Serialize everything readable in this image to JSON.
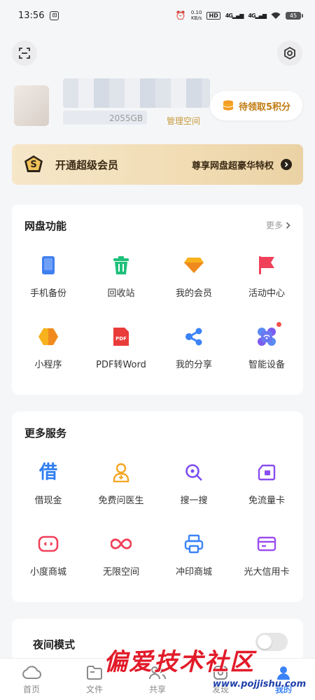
{
  "status_bar": {
    "time": "13:56",
    "net_speed_value": "0.10",
    "net_speed_unit": "KB/s",
    "hd_label": "HD",
    "signal_1": "4G",
    "signal_2": "4G",
    "battery": "45"
  },
  "profile": {
    "storage": "2055GB",
    "manage_space": "管理空间",
    "points_pill": "待领取5积分"
  },
  "vip_banner": {
    "badge": "S",
    "title": "开通超级会员",
    "desc": "尊享网盘超豪华特权"
  },
  "functions": {
    "title": "网盘功能",
    "more": "更多",
    "items": [
      {
        "label": "手机备份",
        "icon": "phone-backup-icon",
        "color": "#3f7ff0"
      },
      {
        "label": "回收站",
        "icon": "recycle-bin-icon",
        "color": "#1fc07a"
      },
      {
        "label": "我的会员",
        "icon": "membership-diamond-icon",
        "color": "#f4a623"
      },
      {
        "label": "活动中心",
        "icon": "activity-flag-icon",
        "color": "#f0415a"
      },
      {
        "label": "小程序",
        "icon": "mini-program-icon",
        "color": "#f7b21e"
      },
      {
        "label": "PDF转Word",
        "icon": "pdf-icon",
        "color": "#ea3b3b"
      },
      {
        "label": "我的分享",
        "icon": "share-icon",
        "color": "#3b82f6"
      },
      {
        "label": "智能设备",
        "icon": "smart-device-icon",
        "color": "#4f7ef0"
      }
    ]
  },
  "more_services": {
    "title": "更多服务",
    "items": [
      {
        "label": "借现金",
        "icon": "borrow-cash-icon",
        "color": "#2f7ef0"
      },
      {
        "label": "免费问医生",
        "icon": "doctor-icon",
        "color": "#f4a623"
      },
      {
        "label": "搜一搜",
        "icon": "search-icon",
        "color": "#7b4df0"
      },
      {
        "label": "免流量卡",
        "icon": "sim-card-icon",
        "color": "#8a4df0"
      },
      {
        "label": "小度商城",
        "icon": "xiaodu-mall-icon",
        "color": "#f0415a"
      },
      {
        "label": "无限空间",
        "icon": "infinity-icon",
        "color": "#f0415a"
      },
      {
        "label": "冲印商城",
        "icon": "printer-icon",
        "color": "#3b82f6"
      },
      {
        "label": "光大信用卡",
        "icon": "credit-card-icon",
        "color": "#9b4df0"
      }
    ]
  },
  "night_mode": {
    "label": "夜间模式"
  },
  "tab_bar": {
    "tabs": [
      {
        "label": "首页",
        "icon": "home-cloud-icon"
      },
      {
        "label": "文件",
        "icon": "folder-icon"
      },
      {
        "label": "共享",
        "icon": "shared-icon"
      },
      {
        "label": "发现",
        "icon": "discover-icon"
      },
      {
        "label": "我的",
        "icon": "profile-icon"
      }
    ],
    "active_index": 4
  },
  "watermark": {
    "main": "偏爱技术社区",
    "url": "www.pojjishu.com"
  }
}
